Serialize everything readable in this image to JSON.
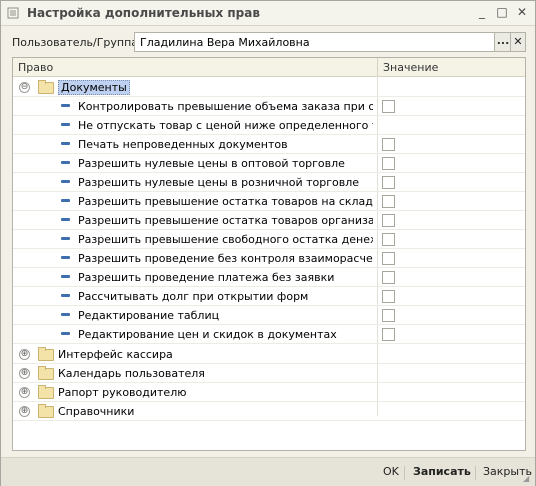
{
  "window": {
    "title": "Настройка дополнительных прав",
    "minimize_glyph": "_",
    "maximize_glyph": "□",
    "close_glyph": "✕"
  },
  "user": {
    "label": "Пользователь/Группа:",
    "value": "Гладилина Вера Михайловна",
    "pick_glyph": "...",
    "clear_glyph": "✕"
  },
  "grid": {
    "columns": [
      "Право",
      "Значение"
    ],
    "group_open": {
      "name": "Документы",
      "expander": "⊖"
    },
    "items": [
      {
        "label": "Контролировать превышение объема заказа при отгру...",
        "checkbox": true
      },
      {
        "label": "Не отпускать товар с ценой ниже определенного типа",
        "checkbox": false
      },
      {
        "label": "Печать непроведенных документов",
        "checkbox": true
      },
      {
        "label": "Разрешить нулевые цены в оптовой торговле",
        "checkbox": true
      },
      {
        "label": "Разрешить нулевые цены в розничной торговле",
        "checkbox": true
      },
      {
        "label": "Разрешить превышение остатка товаров на складе",
        "checkbox": true
      },
      {
        "label": "Разрешить превышение остатка товаров организации",
        "checkbox": true
      },
      {
        "label": "Разрешить превышение свободного остатка денежных ...",
        "checkbox": true
      },
      {
        "label": "Разрешить проведение без контроля взаиморасчетов",
        "checkbox": true
      },
      {
        "label": "Разрешить проведение платежа без заявки",
        "checkbox": true
      },
      {
        "label": "Рассчитывать долг при открытии форм",
        "checkbox": true
      },
      {
        "label": "Редактирование таблиц",
        "checkbox": true
      },
      {
        "label": "Редактирование цен и скидок в документах",
        "checkbox": true
      }
    ],
    "groups_closed": [
      {
        "name": "Интерфейс кассира",
        "expander": "⊕"
      },
      {
        "name": "Календарь пользователя",
        "expander": "⊕"
      },
      {
        "name": "Рапорт руководителю",
        "expander": "⊕"
      },
      {
        "name": "Справочники",
        "expander": "⊕"
      }
    ]
  },
  "footer": {
    "ok": "OK",
    "save": "Записать",
    "close": "Закрыть"
  }
}
